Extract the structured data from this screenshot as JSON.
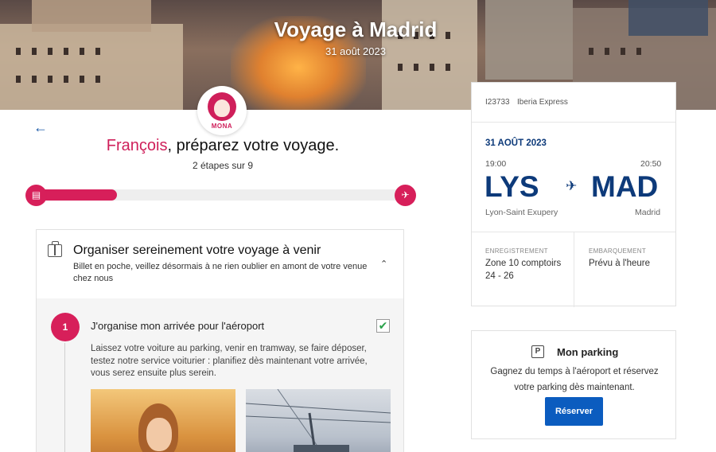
{
  "hero": {
    "title": "Voyage à Madrid",
    "date": "31 août 2023"
  },
  "assistant": {
    "name": "MONA"
  },
  "header": {
    "first_name": "François",
    "greeting_rest": ", préparez votre voyage.",
    "steps": "2 étapes sur 9"
  },
  "progress": {
    "fraction": 0.22
  },
  "card": {
    "title": "Organiser sereinement votre voyage à venir",
    "description": "Billet en poche, veillez désormais à ne rien oublier en amont de votre venue chez nous",
    "step": {
      "number": "1",
      "title": "J'organise mon arrivée pour l'aéroport",
      "checked": true,
      "text": "Laissez votre voiture au parking, venir en tramway, se faire déposer, testez notre service voiturier : planifiez dès maintenant votre arrivée, vous serez ensuite plus serein."
    }
  },
  "flight": {
    "number": "I23733",
    "carrier": "Iberia Express",
    "date": "31 AOÛT 2023",
    "departure": {
      "time": "19:00",
      "code": "LYS",
      "city": "Lyon-Saint Exupery"
    },
    "arrival": {
      "time": "20:50",
      "code": "MAD",
      "city": "Madrid"
    },
    "checkin": {
      "label": "ENREGISTREMENT",
      "value": "Zone 10 comptoirs 24 - 26"
    },
    "boarding": {
      "label": "EMBARQUEMENT",
      "value": "Prévu à l'heure"
    }
  },
  "parking": {
    "icon_letter": "P",
    "title": "Mon parking",
    "text": "Gagnez du temps à l'aéroport et réservez votre parking dès maintenant.",
    "button": "Réserver"
  },
  "colors": {
    "accent": "#d71f5a",
    "navy": "#0d3a7a",
    "button": "#0b5cbf"
  }
}
